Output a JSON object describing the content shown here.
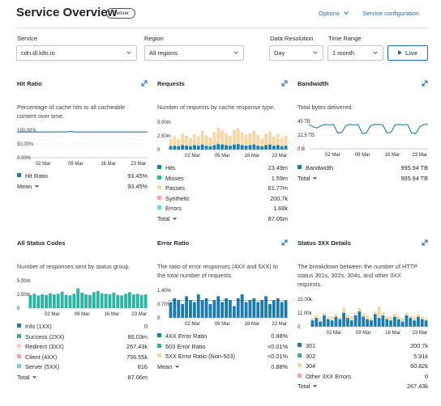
{
  "header": {
    "title": "Service Overview",
    "badge": "Deliver",
    "options_label": "Options",
    "service_config_label": "Service configuration"
  },
  "filters": {
    "service_label": "Service",
    "service_value": "cdn.dl.k8s.io",
    "region_label": "Region",
    "region_value": "All regions",
    "resolution_label": "Data Resolution",
    "resolution_value": "Day",
    "timerange_label": "Time Range",
    "timerange_value": "1 month",
    "live_label": "Live"
  },
  "colors": {
    "accent": "#1d6bb5",
    "blue": "#1e7bb0",
    "teal": "#2bb5a4",
    "cream": "#f7d8a5",
    "pink": "#f2a7a5",
    "lightblue": "#79cde8"
  },
  "panels": {
    "hit_ratio": {
      "title": "Hit Ratio",
      "description_line1": "Percentage of cache hits to all cacheable",
      "description_line2": "content over time.",
      "legend": [
        {
          "label": "Hit Ratio",
          "value": "93.45%",
          "color": "#1e7bb0"
        }
      ],
      "mean_label": "Mean",
      "mean_value": "93.45%",
      "chart_data": {
        "type": "line",
        "yticks": [
          "100.00%",
          "50.00%",
          "0.00%"
        ],
        "xticks": [
          "02 Mar",
          "09 Mar",
          "16 Mar",
          "23 Mar"
        ],
        "series": [
          {
            "name": "Hit Ratio",
            "values": [
              0.935,
              0.934,
              0.936,
              0.935,
              0.934,
              0.935,
              0.936,
              0.934,
              0.935,
              0.935,
              0.937,
              0.936,
              0.952,
              0.936,
              0.935,
              0.935,
              0.934,
              0.935,
              0.936,
              0.935,
              0.935,
              0.936,
              0.935,
              0.934,
              0.935,
              0.936,
              0.935,
              0.935,
              0.934,
              0.935
            ]
          }
        ]
      }
    },
    "requests": {
      "title": "Requests",
      "description": "Number of requests by cache response type.",
      "legend": [
        {
          "label": "Hits",
          "value": "23.49m",
          "color": "#1e7bb0"
        },
        {
          "label": "Misses",
          "value": "1.59m",
          "color": "#2bb5a4"
        },
        {
          "label": "Passes",
          "value": "61.77m",
          "color": "#f7d8a5"
        },
        {
          "label": "Synthetic",
          "value": "200.7k",
          "color": "#f2a7a5"
        },
        {
          "label": "Errors",
          "value": "1.68k",
          "color": "#79cde8"
        }
      ],
      "total_label": "Total",
      "total_value": "87.06m",
      "chart_data": {
        "type": "bar",
        "stacked": true,
        "yticks": [
          "5.00m",
          "2.50m",
          "0"
        ],
        "xticks": [
          "02 Mar",
          "09 Mar",
          "16 Mar",
          "23 Mar"
        ],
        "ymax": 5.0,
        "series": [
          {
            "name": "Hits",
            "values": [
              0.6,
              0.7,
              0.6,
              0.8,
              0.7,
              0.6,
              0.8,
              0.7,
              0.9,
              0.7,
              0.6,
              0.8,
              1.0,
              0.9,
              0.8,
              0.7,
              0.9,
              1.0,
              0.8,
              0.7,
              0.8,
              0.9,
              0.7,
              0.6,
              0.8,
              0.9,
              0.7,
              0.8,
              0.6,
              0.7
            ]
          },
          {
            "name": "Misses",
            "values": [
              0.05,
              0.06,
              0.05,
              0.05,
              0.06,
              0.05,
              0.05,
              0.06,
              0.05,
              0.05,
              0.05,
              0.06,
              0.07,
              0.06,
              0.05,
              0.05,
              0.06,
              0.06,
              0.05,
              0.05,
              0.05,
              0.06,
              0.05,
              0.05,
              0.06,
              0.05,
              0.05,
              0.06,
              0.05,
              0.05
            ]
          },
          {
            "name": "Passes",
            "values": [
              1.3,
              1.6,
              1.2,
              2.0,
              1.7,
              1.4,
              1.9,
              1.6,
              2.4,
              1.8,
              1.5,
              2.3,
              2.9,
              2.5,
              2.1,
              1.7,
              2.6,
              2.8,
              2.2,
              1.9,
              2.1,
              2.4,
              1.8,
              1.3,
              2.0,
              2.3,
              1.6,
              2.0,
              1.5,
              1.7
            ]
          },
          {
            "name": "Synthetic",
            "values": [
              0.01,
              0.01,
              0.01,
              0.01,
              0.01,
              0.01,
              0.01,
              0.01,
              0.01,
              0.01,
              0.01,
              0.01,
              0.01,
              0.01,
              0.01,
              0.01,
              0.01,
              0.01,
              0.01,
              0.01,
              0.01,
              0.01,
              0.01,
              0.01,
              0.01,
              0.01,
              0.01,
              0.01,
              0.01,
              0.01
            ]
          }
        ]
      }
    },
    "bandwidth": {
      "title": "Bandwidth",
      "description": "Total bytes delivered.",
      "legend": [
        {
          "label": "Bandwidth",
          "value": "995.94 TB",
          "color": "#1e7bb0"
        }
      ],
      "total_label": "Total",
      "total_value": "995.94 TB",
      "chart_data": {
        "type": "line",
        "yticks": [
          "45 TB",
          "22.5 TB",
          "0 B"
        ],
        "xticks": [
          "02 Mar",
          "09 Mar",
          "16 Mar",
          "23 Mar"
        ],
        "ymax": 45,
        "series": [
          {
            "name": "Bandwidth",
            "values": [
              40,
              36,
              34,
              38,
              40,
              39,
              40,
              26,
              27,
              38,
              40,
              39,
              40,
              25,
              26,
              38,
              40,
              40,
              39,
              26,
              27,
              39,
              40,
              39,
              40,
              26,
              25,
              36,
              40,
              40
            ]
          }
        ]
      }
    },
    "status_codes": {
      "title": "All Status Codes",
      "description": "Number of responses sent by status group.",
      "legend": [
        {
          "label": "Info (1XX)",
          "value": "0",
          "color": "#1e7bb0"
        },
        {
          "label": "Success (2XX)",
          "value": "86.03m",
          "color": "#2bb5a4"
        },
        {
          "label": "Redirect (3XX)",
          "value": "267.43k",
          "color": "#f7d8a5"
        },
        {
          "label": "Client (4XX)",
          "value": "756.55k",
          "color": "#f2a7a5"
        },
        {
          "label": "Server (5XX)",
          "value": "816",
          "color": "#79cde8"
        }
      ],
      "total_label": "Total",
      "total_value": "87.06m",
      "chart_data": {
        "type": "bar",
        "stacked": true,
        "yticks": [
          "5.00m",
          "2.50m",
          "0"
        ],
        "xticks": [
          "02 Mar",
          "09 Mar",
          "16 Mar",
          "23 Mar"
        ],
        "ymax": 5.0,
        "series": [
          {
            "name": "Success (2XX)",
            "values": [
              2.4,
              2.6,
              2.3,
              2.5,
              2.4,
              2.7,
              2.5,
              2.6,
              3.0,
              2.4,
              2.3,
              2.6,
              3.6,
              2.8,
              2.5,
              2.4,
              2.9,
              3.1,
              2.7,
              2.6,
              2.5,
              2.8,
              2.4,
              2.3,
              2.6,
              2.9,
              2.5,
              2.6,
              2.4,
              2.5
            ]
          },
          {
            "name": "Client (4XX)",
            "values": [
              0.02,
              0.03,
              0.02,
              0.03,
              0.02,
              0.03,
              0.02,
              0.03,
              0.03,
              0.02,
              0.02,
              0.03,
              0.03,
              0.03,
              0.02,
              0.02,
              0.03,
              0.03,
              0.02,
              0.02,
              0.02,
              0.03,
              0.02,
              0.02,
              0.03,
              0.03,
              0.02,
              0.02,
              0.02,
              0.02
            ]
          }
        ]
      }
    },
    "error_ratio": {
      "title": "Error Ratio",
      "description_line1": "The ratio of error responses (4XX and 5XX) to",
      "description_line2": "the total number of requests.",
      "legend": [
        {
          "label": "4XX Error Ratio",
          "value": "0.88%",
          "color": "#1e7bb0"
        },
        {
          "label": "503 Error Ratio",
          "value": "<0.01%",
          "color": "#2bb5a4"
        },
        {
          "label": "5XX Error Ratio (Non-503)",
          "value": "<0.01%",
          "color": "#f7d8a5"
        }
      ],
      "mean_label": "Mean",
      "mean_value": "0.88%",
      "chart_data": {
        "type": "bar",
        "yticks": [
          "1.40%",
          "0.70%",
          "0"
        ],
        "xticks": [
          "02 Mar",
          "09 Mar",
          "16 Mar",
          "23 Mar"
        ],
        "ymax": 1.4,
        "mean": 0.88,
        "series": [
          {
            "name": "4XX Error Ratio",
            "values": [
              0.8,
              1.0,
              0.9,
              0.7,
              1.1,
              0.9,
              0.8,
              1.2,
              0.9,
              1.0,
              0.7,
              0.9,
              1.1,
              0.8,
              1.0,
              0.9,
              0.6,
              1.0,
              1.2,
              0.8,
              0.9,
              1.0,
              0.8,
              0.9,
              1.1,
              0.7,
              0.9,
              1.0,
              0.8,
              0.9
            ]
          }
        ]
      }
    },
    "status_3xx": {
      "title": "Status 3XX Details",
      "description_line1": "The breakdown between the number of HTTP",
      "description_line2": "status 301s, 302s, 304s, and other 3XX",
      "description_line3": "requests.",
      "legend": [
        {
          "label": "301",
          "value": "200.7k",
          "color": "#1e7bb0"
        },
        {
          "label": "302",
          "value": "5.91k",
          "color": "#2bb5a4"
        },
        {
          "label": "304",
          "value": "60.82k",
          "color": "#f7d8a5"
        },
        {
          "label": "Other 3XX Errors",
          "value": "0",
          "color": "#f2a7a5"
        }
      ],
      "total_label": "Total",
      "total_value": "267.43k",
      "chart_data": {
        "type": "bar",
        "stacked": true,
        "yticks": [
          "22.00k",
          "11.00k",
          "0"
        ],
        "xticks": [
          "02 Mar",
          "09 Mar",
          "16 Mar",
          "23 Mar"
        ],
        "ymax": 22,
        "series": [
          {
            "name": "301",
            "values": [
              5,
              7,
              4,
              9,
              6,
              5,
              8,
              6,
              11,
              7,
              5,
              9,
              12,
              8,
              6,
              5,
              10,
              7,
              9,
              6,
              5,
              8,
              6,
              4,
              9,
              7,
              5,
              8,
              6,
              5
            ]
          },
          {
            "name": "302",
            "values": [
              0.2,
              0.2,
              0.1,
              0.2,
              0.2,
              0.2,
              0.2,
              0.2,
              0.3,
              0.2,
              0.2,
              0.2,
              0.3,
              0.2,
              0.2,
              0.2,
              0.2,
              0.2,
              0.2,
              0.2,
              0.2,
              0.2,
              0.2,
              0.1,
              0.2,
              0.2,
              0.2,
              0.2,
              0.2,
              0.2
            ]
          },
          {
            "name": "304",
            "values": [
              2,
              2,
              3,
              2,
              2,
              3,
              2,
              2,
              4,
              2,
              3,
              2,
              3,
              2,
              3,
              2,
              2,
              9,
              2,
              2,
              3,
              2,
              2,
              3,
              2,
              2,
              3,
              2,
              2,
              2
            ]
          }
        ]
      }
    }
  }
}
